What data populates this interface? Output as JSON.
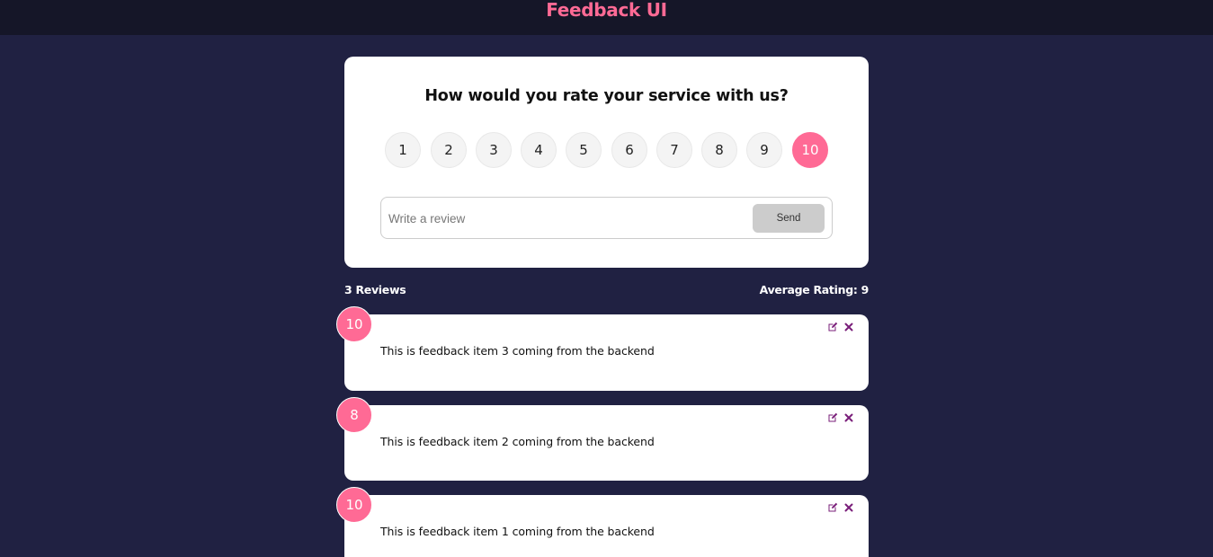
{
  "header": {
    "title": "Feedback UI"
  },
  "form": {
    "title": "How would you rate your service with us?",
    "ratings": [
      "1",
      "2",
      "3",
      "4",
      "5",
      "6",
      "7",
      "8",
      "9",
      "10"
    ],
    "selected_rating": "10",
    "review_placeholder": "Write a review",
    "review_value": "",
    "send_label": "Send"
  },
  "stats": {
    "count_label": "3 Reviews",
    "average_label": "Average Rating: 9"
  },
  "feedback": [
    {
      "rating": "10",
      "text": "This is feedback item 3 coming from the backend"
    },
    {
      "rating": "8",
      "text": "This is feedback item 2 coming from the backend"
    },
    {
      "rating": "10",
      "text": "This is feedback item 1 coming from the backend"
    }
  ],
  "colors": {
    "accent": "#ff6a95",
    "page_bg": "#202142",
    "header_bg": "#151628",
    "icon": "#7a1f7a"
  },
  "icons": {
    "edit": "edit-icon",
    "delete": "close-icon"
  }
}
